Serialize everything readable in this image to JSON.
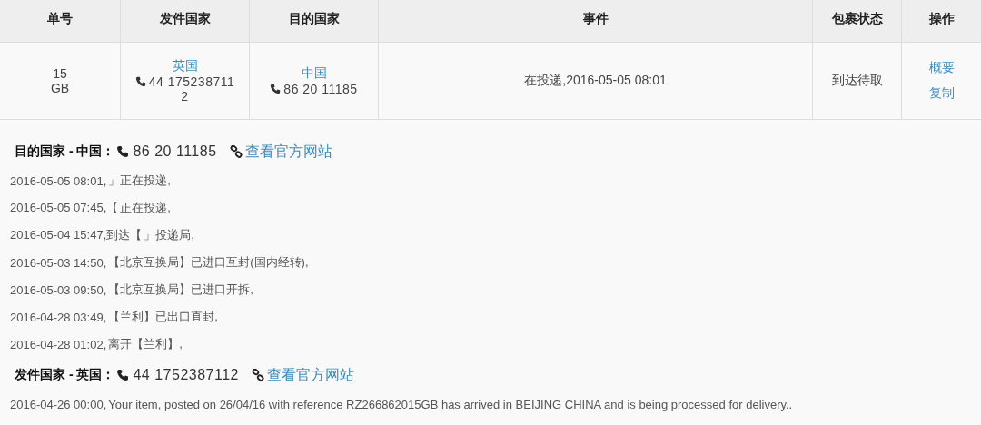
{
  "table": {
    "columns": [
      "单号",
      "发件国家",
      "目的国家",
      "事件",
      "包裹状态",
      "操作"
    ],
    "row": {
      "tracking": [
        "15",
        "GB"
      ],
      "origin": {
        "country": "英国",
        "phone": "44 175238711",
        "phone_wrap": "2"
      },
      "destination": {
        "country": "中国",
        "phone": "86 20 11185"
      },
      "event": "在投递,2016-05-05 08:01",
      "status": "到达待取",
      "actions": [
        "概要",
        "复制"
      ]
    }
  },
  "sections": [
    {
      "heading": "目的国家 - 中国：",
      "phone": "86 20 11185",
      "link": "查看官方网站",
      "events": [
        {
          "time": "2016-05-05 08:01,",
          "text": "」正在投递,"
        },
        {
          "time": "2016-05-05 07:45,【",
          "text": "正在投递,"
        },
        {
          "time": "2016-05-04 15:47,到达【",
          "text": "」投递局,"
        },
        {
          "time": "2016-05-03 14:50,",
          "text": "【北京互换局】已进口互封(国内经转),"
        },
        {
          "time": "2016-05-03 09:50,",
          "text": "【北京互换局】已进口开拆,"
        },
        {
          "time": "2016-04-28 03:49,",
          "text": "【兰利】已出口直封,"
        },
        {
          "time": "2016-04-28 01:02,",
          "text": "离开【兰利】,"
        }
      ]
    },
    {
      "heading": "发件国家 - 英国：",
      "phone": "44 1752387112",
      "link": "查看官方网站",
      "events": [
        {
          "time": "2016-04-26 00:00,",
          "text": "Your item, posted on 26/04/16 with reference RZ266862015GB has arrived in BEIJING CHINA and is being processed for delivery.."
        }
      ]
    }
  ]
}
